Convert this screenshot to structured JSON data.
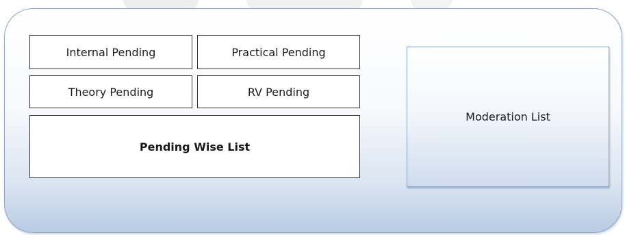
{
  "buttons": {
    "internal_pending": "Internal Pending",
    "practical_pending": "Practical Pending",
    "theory_pending": "Theory Pending",
    "rv_pending": "RV Pending",
    "pending_wise_list": "Pending Wise List",
    "moderation_list": "Moderation List"
  },
  "colors": {
    "panel_border": "#8aa3c4",
    "panel_gradient_bottom": "#b8cbe3",
    "button_border": "#333333"
  }
}
